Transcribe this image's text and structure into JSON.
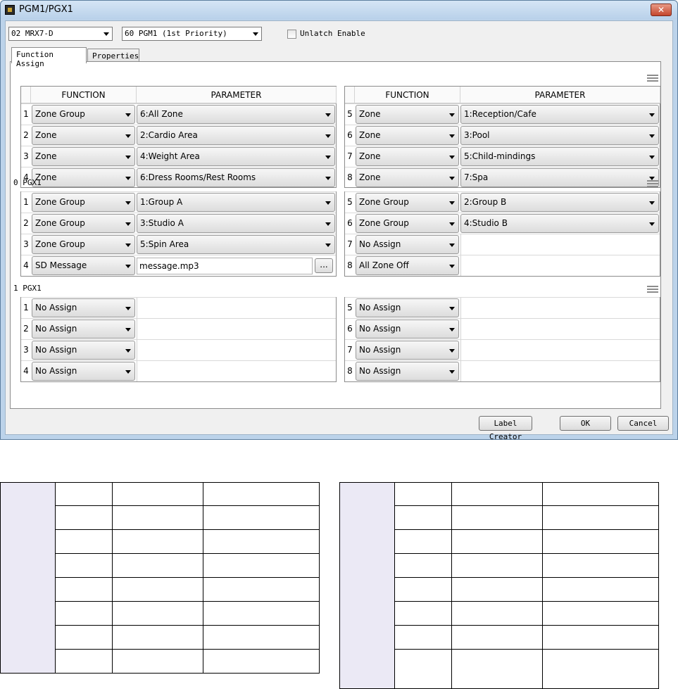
{
  "window": {
    "title": "PGM1/PGX1",
    "close_label": "✕"
  },
  "toolbar": {
    "device_select": "02 MRX7-D",
    "pgm_select": "60 PGM1 (1st Priority)",
    "unlatch_label": "Unlatch Enable",
    "unlatch_checked": false
  },
  "tabs": [
    {
      "label": "Function Assign",
      "active": true
    },
    {
      "label": "Properties",
      "active": false
    }
  ],
  "headers": {
    "function": "FUNCTION",
    "parameter": "PARAMETER"
  },
  "groups": [
    {
      "label": "",
      "left": [
        {
          "num": "1",
          "function": "Zone Group",
          "parameter": "6:All Zone"
        },
        {
          "num": "2",
          "function": "Zone",
          "parameter": "2:Cardio Area"
        },
        {
          "num": "3",
          "function": "Zone",
          "parameter": "4:Weight Area"
        },
        {
          "num": "4",
          "function": "Zone",
          "parameter": "6:Dress Rooms/Rest Rooms"
        }
      ],
      "right": [
        {
          "num": "5",
          "function": "Zone",
          "parameter": "1:Reception/Cafe"
        },
        {
          "num": "6",
          "function": "Zone",
          "parameter": "3:Pool"
        },
        {
          "num": "7",
          "function": "Zone",
          "parameter": "5:Child-mindings"
        },
        {
          "num": "8",
          "function": "Zone",
          "parameter": "7:Spa"
        }
      ]
    },
    {
      "label": "0 PGX1",
      "left": [
        {
          "num": "1",
          "function": "Zone Group",
          "parameter": "1:Group A"
        },
        {
          "num": "2",
          "function": "Zone Group",
          "parameter": "3:Studio A"
        },
        {
          "num": "3",
          "function": "Zone Group",
          "parameter": "5:Spin Area"
        },
        {
          "num": "4",
          "function": "SD Message",
          "parameter": "message.mp3",
          "text_field": true,
          "browse_label": "..."
        }
      ],
      "right": [
        {
          "num": "5",
          "function": "Zone Group",
          "parameter": "2:Group B"
        },
        {
          "num": "6",
          "function": "Zone Group",
          "parameter": "4:Studio B"
        },
        {
          "num": "7",
          "function": "No Assign",
          "parameter": ""
        },
        {
          "num": "8",
          "function": "All Zone Off",
          "parameter": ""
        }
      ]
    },
    {
      "label": "1 PGX1",
      "left": [
        {
          "num": "1",
          "function": "No Assign",
          "parameter": ""
        },
        {
          "num": "2",
          "function": "No Assign",
          "parameter": ""
        },
        {
          "num": "3",
          "function": "No Assign",
          "parameter": ""
        },
        {
          "num": "4",
          "function": "No Assign",
          "parameter": ""
        }
      ],
      "right": [
        {
          "num": "5",
          "function": "No Assign",
          "parameter": ""
        },
        {
          "num": "6",
          "function": "No Assign",
          "parameter": ""
        },
        {
          "num": "7",
          "function": "No Assign",
          "parameter": ""
        },
        {
          "num": "8",
          "function": "No Assign",
          "parameter": ""
        }
      ]
    }
  ],
  "footer": {
    "label_creator": "Label Creator",
    "ok": "OK",
    "cancel": "Cancel"
  },
  "icons": {
    "menu": "menu-icon",
    "dropdown": "chevron-down-icon"
  },
  "colors": {
    "title_bar": "#bcd3ea",
    "close_button": "#c4462d",
    "table_side_fill": "#ebe9f5"
  }
}
